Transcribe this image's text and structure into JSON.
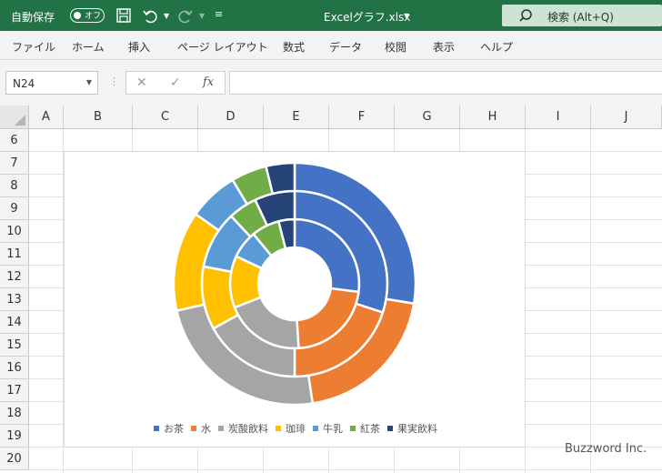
{
  "titlebar": {
    "autosave_label": "自動保存",
    "autosave_state": "オフ",
    "doc_title": "Excelグラフ.xlsx",
    "search_text": "検索 (Alt+Q)"
  },
  "ribbon": {
    "tabs": [
      "ファイル",
      "ホーム",
      "挿入",
      "ページ レイアウト",
      "数式",
      "データ",
      "校閲",
      "表示",
      "ヘルプ"
    ]
  },
  "formula_bar": {
    "name_box": "N24",
    "cancel": "✕",
    "enter": "✓",
    "fx": "fx",
    "value": ""
  },
  "sheet": {
    "columns": [
      "A",
      "B",
      "C",
      "D",
      "E",
      "F",
      "G",
      "H",
      "I",
      "J"
    ],
    "rows": [
      "6",
      "7",
      "8",
      "9",
      "10",
      "11",
      "12",
      "13",
      "14",
      "15",
      "16",
      "17",
      "18",
      "19",
      "20"
    ]
  },
  "chart_data": {
    "type": "doughnut",
    "categories": [
      "お茶",
      "水",
      "炭酸飲料",
      "珈琲",
      "牛乳",
      "紅茶",
      "果実飲料"
    ],
    "colors": [
      "#4472C4",
      "#ED7D31",
      "#A5A5A5",
      "#FFC000",
      "#5B9BD5",
      "#70AD47",
      "#264478"
    ],
    "series": [
      {
        "values": [
          27,
          22,
          20,
          13,
          7,
          7,
          4
        ]
      },
      {
        "values": [
          30,
          20,
          17,
          11,
          10,
          5,
          7
        ]
      },
      {
        "values": [
          29,
          21,
          25,
          14,
          7,
          5,
          4
        ]
      }
    ],
    "legend_position": "bottom"
  },
  "watermark": "Buzzword Inc."
}
